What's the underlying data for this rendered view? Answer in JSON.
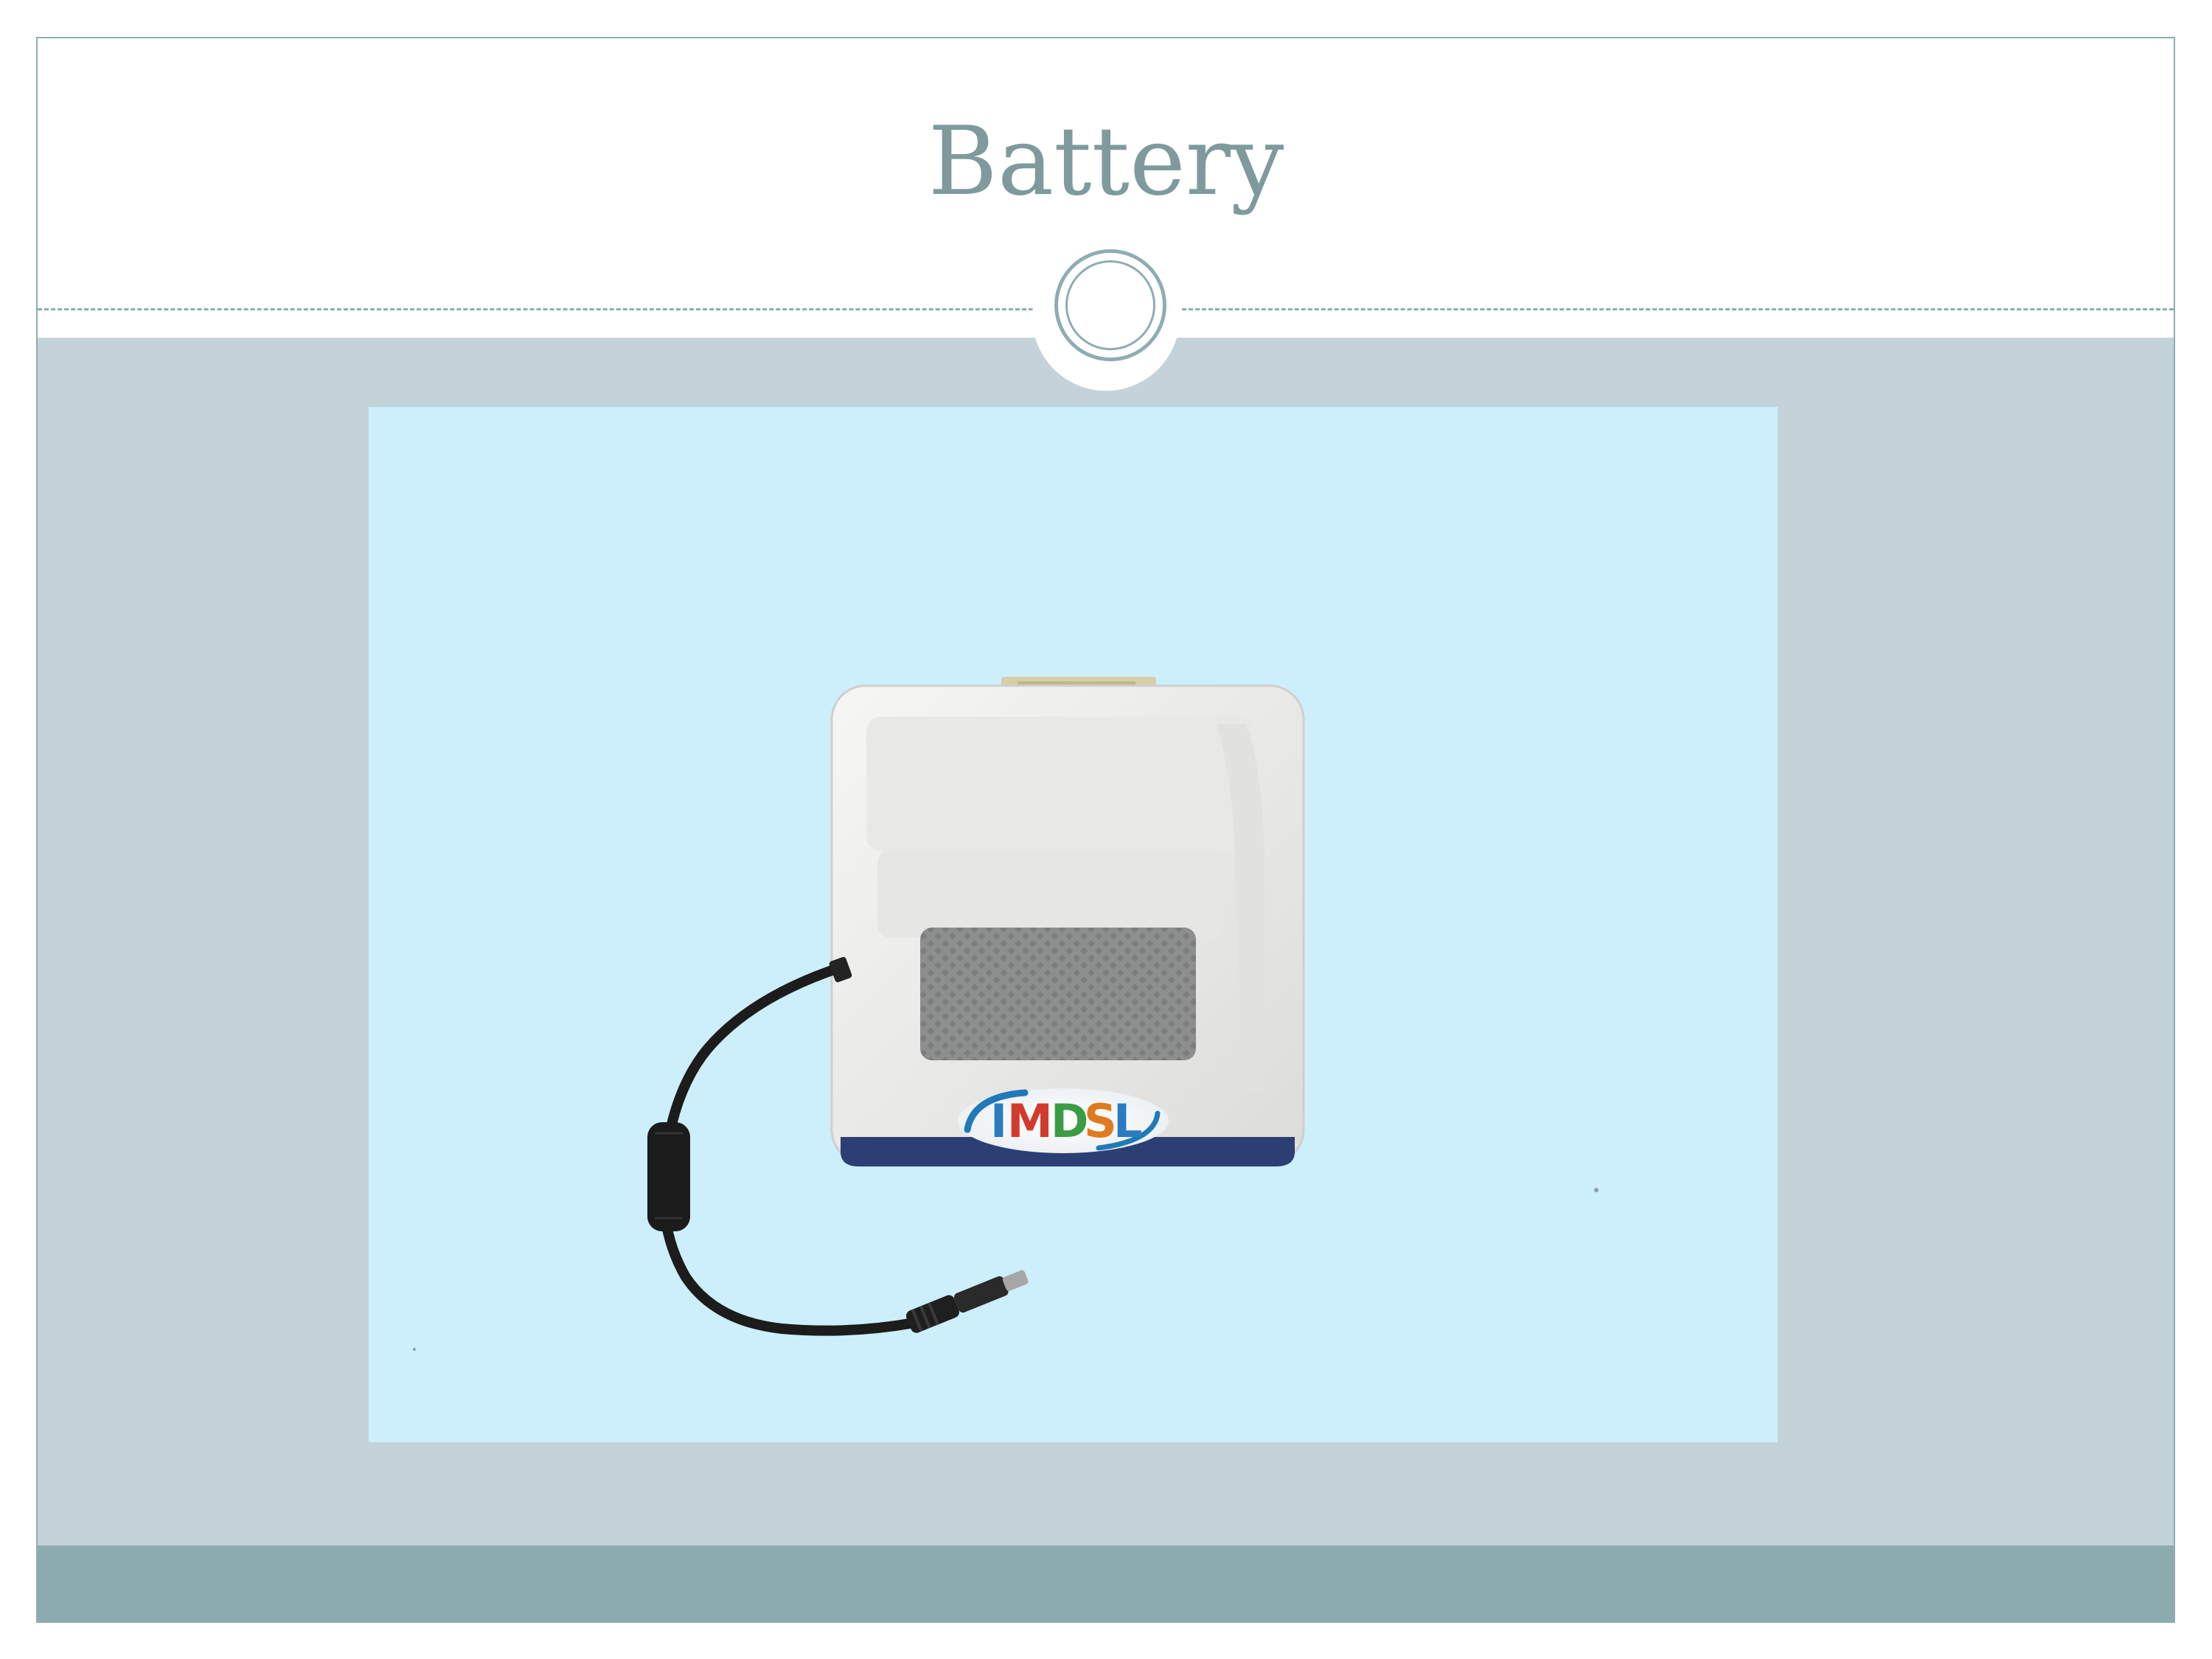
{
  "slide": {
    "title": "Battery"
  },
  "photo": {
    "subject": "battery-pack-with-dc-cable",
    "logo_text": "IMDSL",
    "colors": {
      "background": "#cdeefb",
      "casing": "#ececea",
      "grip_pad": "#8d8e8e",
      "cable": "#1c1c1c"
    }
  },
  "theme": {
    "title_color": "#7e9a9c",
    "accent_line": "#8fadb0",
    "content_band": "#c4d3d9",
    "footer_band": "#8cabaf"
  }
}
